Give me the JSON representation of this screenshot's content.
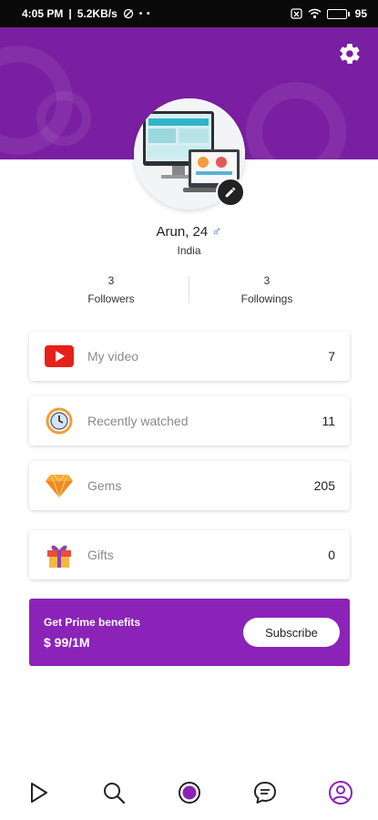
{
  "status_bar": {
    "time": "4:05 PM",
    "speed": "5.2KB/s",
    "battery": "95"
  },
  "profile": {
    "name": "Arun, 24",
    "gender_symbol": "♂",
    "country": "India"
  },
  "stats": {
    "followers_count": "3",
    "followers_label": "Followers",
    "followings_count": "3",
    "followings_label": "Followings"
  },
  "menu": [
    {
      "label": "My video",
      "count": "7",
      "icon": "youtube-play-icon"
    },
    {
      "label": "Recently watched",
      "count": "11",
      "icon": "clock-history-icon"
    },
    {
      "label": "Gems",
      "count": "205",
      "icon": "gem-icon"
    },
    {
      "label": "Gifts",
      "count": "0",
      "icon": "gift-icon"
    }
  ],
  "prime": {
    "title": "Get Prime benefits",
    "price": "$ 99/1M",
    "button": "Subscribe"
  },
  "nav": [
    "play-icon",
    "search-icon",
    "live-dot-icon",
    "chat-icon",
    "profile-icon"
  ],
  "colors": {
    "primary": "#7b1fa2",
    "prime_banner": "#8c23b8",
    "accent_nav": "#8c23b8"
  }
}
